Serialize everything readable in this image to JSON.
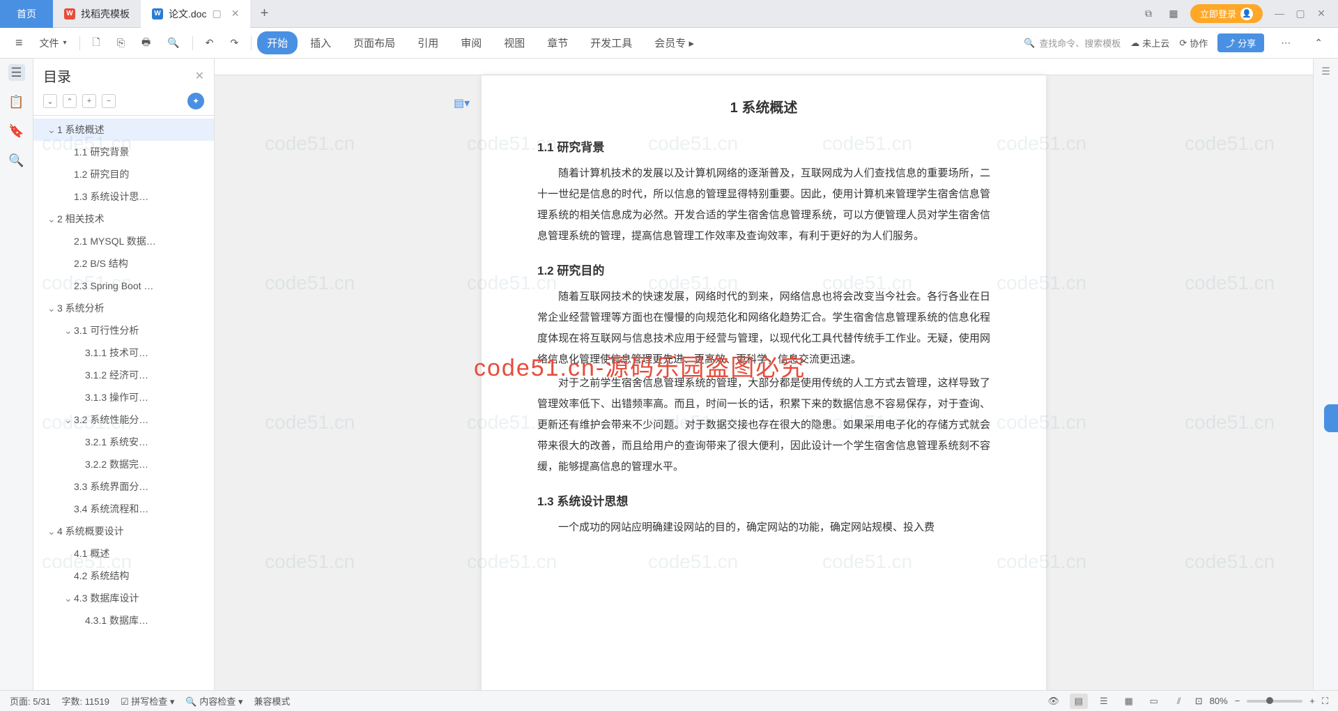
{
  "tabs": {
    "home": "首页",
    "items": [
      {
        "icon": "W",
        "label": "找稻壳模板"
      },
      {
        "icon": "W",
        "label": "论文.doc"
      }
    ],
    "login": "立即登录"
  },
  "toolbar": {
    "file": "文件",
    "ribbon": [
      "开始",
      "插入",
      "页面布局",
      "引用",
      "审阅",
      "视图",
      "章节",
      "开发工具",
      "会员专"
    ],
    "active_ribbon": 0,
    "search": "查找命令、搜索模板",
    "cloud": "未上云",
    "collab": "协作",
    "share": "分享"
  },
  "outline": {
    "title": "目录",
    "items": [
      {
        "level": 1,
        "text": "1 系统概述",
        "exp": true,
        "active": true
      },
      {
        "level": 2,
        "text": "1.1 研究背景"
      },
      {
        "level": 2,
        "text": "1.2 研究目的"
      },
      {
        "level": 2,
        "text": "1.3 系统设计思…"
      },
      {
        "level": 1,
        "text": "2 相关技术",
        "exp": true
      },
      {
        "level": 2,
        "text": "2.1 MYSQL 数据…"
      },
      {
        "level": 2,
        "text": "2.2 B/S 结构"
      },
      {
        "level": 2,
        "text": "2.3 Spring Boot …"
      },
      {
        "level": 1,
        "text": "3 系统分析",
        "exp": true
      },
      {
        "level": 2,
        "text": "3.1 可行性分析",
        "exp": true
      },
      {
        "level": 3,
        "text": "3.1.1 技术可…"
      },
      {
        "level": 3,
        "text": "3.1.2 经济可…"
      },
      {
        "level": 3,
        "text": "3.1.3 操作可…"
      },
      {
        "level": 2,
        "text": "3.2 系统性能分…",
        "exp": true
      },
      {
        "level": 3,
        "text": "3.2.1 系统安…"
      },
      {
        "level": 3,
        "text": "3.2.2 数据完…"
      },
      {
        "level": 2,
        "text": "3.3 系统界面分…"
      },
      {
        "level": 2,
        "text": "3.4 系统流程和…"
      },
      {
        "level": 1,
        "text": "4 系统概要设计",
        "exp": true
      },
      {
        "level": 2,
        "text": "4.1 概述"
      },
      {
        "level": 2,
        "text": "4.2 系统结构"
      },
      {
        "level": 2,
        "text": "4.3 数据库设计",
        "exp": true
      },
      {
        "level": 3,
        "text": "4.3.1 数据库…"
      }
    ]
  },
  "document": {
    "h1": "1 系统概述",
    "sections": [
      {
        "h2": "1.1  研究背景",
        "p": [
          "随着计算机技术的发展以及计算机网络的逐渐普及，互联网成为人们查找信息的重要场所，二十一世纪是信息的时代，所以信息的管理显得特别重要。因此，使用计算机来管理学生宿舍信息管理系统的相关信息成为必然。开发合适的学生宿舍信息管理系统，可以方便管理人员对学生宿舍信息管理系统的管理，提高信息管理工作效率及查询效率，有利于更好的为人们服务。"
        ]
      },
      {
        "h2": "1.2 研究目的",
        "p": [
          "随着互联网技术的快速发展，网络时代的到来，网络信息也将会改变当今社会。各行各业在日常企业经营管理等方面也在慢慢的向规范化和网络化趋势汇合。学生宿舍信息管理系统的信息化程度体现在将互联网与信息技术应用于经营与管理，以现代化工具代替传统手工作业。无疑，使用网络信息化管理使信息管理更先进、更高效、更科学，信息交流更迅速。",
          "对于之前学生宿舍信息管理系统的管理，大部分都是使用传统的人工方式去管理，这样导致了管理效率低下、出错频率高。而且，时间一长的话，积累下来的数据信息不容易保存，对于查询、更新还有维护会带来不少问题。对于数据交接也存在很大的隐患。如果采用电子化的存储方式就会带来很大的改善，而且给用户的查询带来了很大便利，因此设计一个学生宿舍信息管理系统刻不容缓，能够提高信息的管理水平。"
        ]
      },
      {
        "h2": "1.3 系统设计思想",
        "p": [
          "一个成功的网站应明确建设网站的目的，确定网站的功能，确定网站规模、投入费"
        ]
      }
    ]
  },
  "status": {
    "page": "页面: 5/31",
    "words": "字数: 11519",
    "spell": "拼写检查",
    "content": "内容检查",
    "compat": "兼容模式",
    "zoom": "80%"
  },
  "watermarks": {
    "gray": "code51.cn",
    "red": "code51.cn-源码乐园盗图必究"
  }
}
